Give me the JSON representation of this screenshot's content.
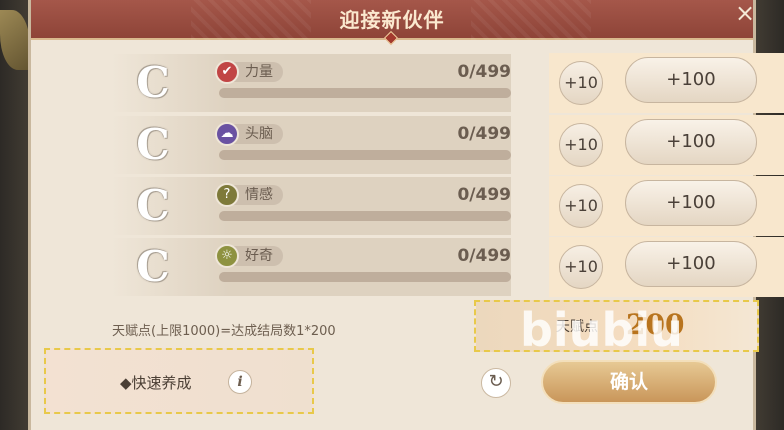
{
  "title": "迎接新伙伴",
  "close_icon": "×",
  "stats": [
    {
      "grade": "C",
      "name": "力量",
      "value": "0/499",
      "level": 0,
      "icon_color": "#c14545",
      "icon_glyph": "✔",
      "btn_small": "+10",
      "btn_large": "+100"
    },
    {
      "grade": "C",
      "name": "头脑",
      "value": "0/499",
      "level": 0,
      "icon_color": "#6a52a2",
      "icon_glyph": "☁",
      "btn_small": "+10",
      "btn_large": "+100"
    },
    {
      "grade": "C",
      "name": "情感",
      "value": "0/499",
      "level": 0,
      "icon_color": "#7e7a3a",
      "icon_glyph": "?",
      "btn_small": "+10",
      "btn_large": "+100"
    },
    {
      "grade": "C",
      "name": "好奇",
      "value": "0/499",
      "level": 0,
      "icon_color": "#8e9240",
      "icon_glyph": "☼",
      "btn_small": "+10",
      "btn_large": "+100"
    }
  ],
  "talent": {
    "note": "天赋点(上限1000)=达成结局数1*200",
    "label": "天赋点",
    "value": "200"
  },
  "watermark": "biubiu",
  "quick": {
    "label": "◆快速养成",
    "info_icon": "i"
  },
  "refresh_icon": "↻",
  "confirm_label": "确认",
  "colors": {
    "header": "#9c4e42",
    "accent": "#c98a48",
    "highlight_border": "#e8c94a"
  }
}
